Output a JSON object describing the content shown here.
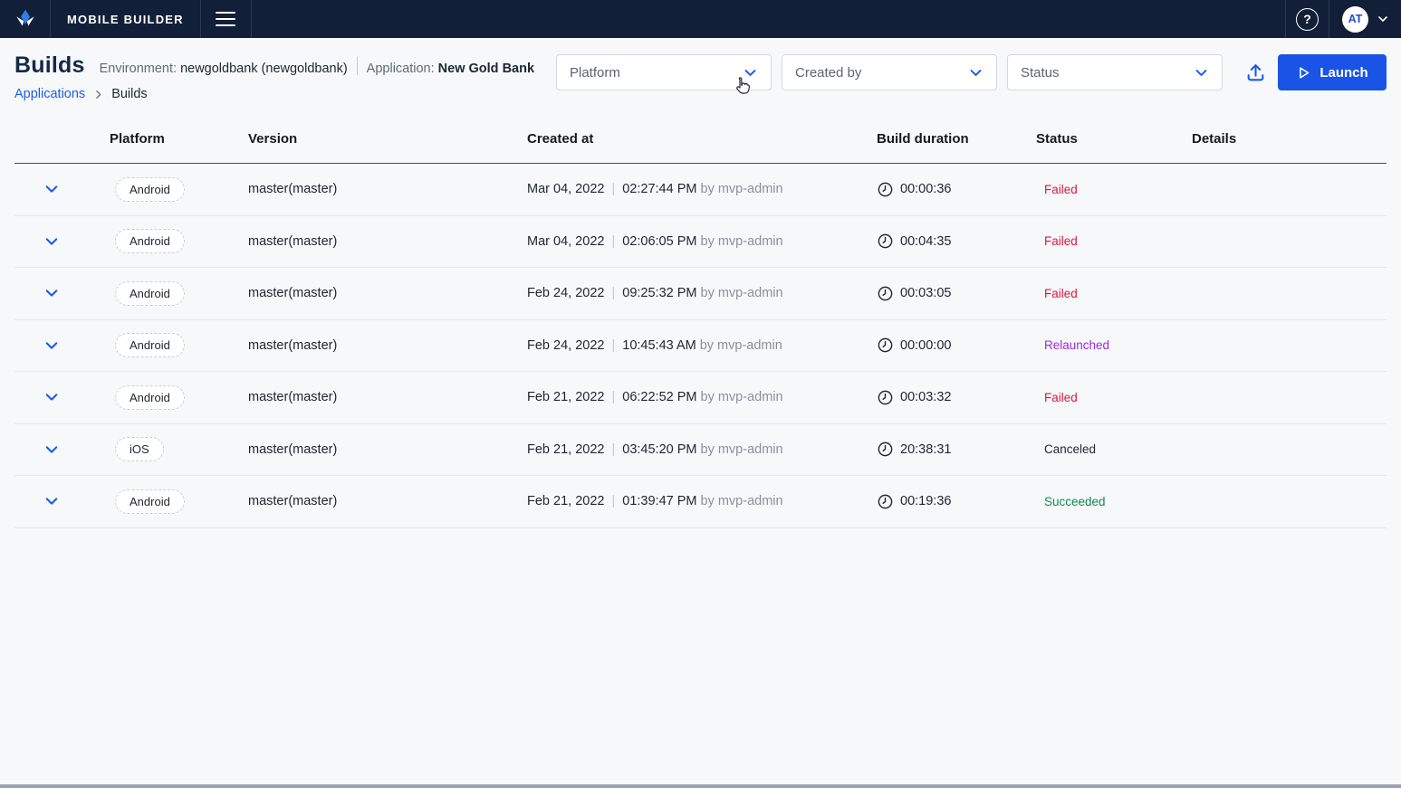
{
  "topbar": {
    "brand": "MOBILE BUILDER",
    "help_glyph": "?",
    "avatar_initials": "AT"
  },
  "header": {
    "title": "Builds",
    "environment_label": "Environment:",
    "environment_value": "newgoldbank (newgoldbank)",
    "application_label": "Application:",
    "application_value": "New Gold Bank",
    "breadcrumb": {
      "root": "Applications",
      "current": "Builds"
    }
  },
  "filters": {
    "platform": "Platform",
    "created_by": "Created by",
    "status": "Status"
  },
  "actions": {
    "launch": "Launch"
  },
  "table": {
    "columns": [
      "Platform",
      "Version",
      "Created at",
      "Build duration",
      "Status",
      "Details"
    ],
    "date_separator": "|",
    "rows": [
      {
        "platform": "Android",
        "version": "master(master)",
        "date": "Mar 04, 2022",
        "time": "02:27:44 PM",
        "by": "by mvp-admin",
        "duration": "00:00:36",
        "status": "Failed"
      },
      {
        "platform": "Android",
        "version": "master(master)",
        "date": "Mar 04, 2022",
        "time": "02:06:05 PM",
        "by": "by mvp-admin",
        "duration": "00:04:35",
        "status": "Failed"
      },
      {
        "platform": "Android",
        "version": "master(master)",
        "date": "Feb 24, 2022",
        "time": "09:25:32 PM",
        "by": "by mvp-admin",
        "duration": "00:03:05",
        "status": "Failed"
      },
      {
        "platform": "Android",
        "version": "master(master)",
        "date": "Feb 24, 2022",
        "time": "10:45:43 AM",
        "by": "by mvp-admin",
        "duration": "00:00:00",
        "status": "Relaunched"
      },
      {
        "platform": "Android",
        "version": "master(master)",
        "date": "Feb 21, 2022",
        "time": "06:22:52 PM",
        "by": "by mvp-admin",
        "duration": "00:03:32",
        "status": "Failed"
      },
      {
        "platform": "iOS",
        "version": "master(master)",
        "date": "Feb 21, 2022",
        "time": "03:45:20 PM",
        "by": "by mvp-admin",
        "duration": "20:38:31",
        "status": "Canceled"
      },
      {
        "platform": "Android",
        "version": "master(master)",
        "date": "Feb 21, 2022",
        "time": "01:39:47 PM",
        "by": "by mvp-admin",
        "duration": "00:19:36",
        "status": "Succeeded"
      }
    ],
    "status_colors": {
      "Failed": "#e0173c",
      "Relaunched": "#9c2bd6",
      "Canceled": "#23272e",
      "Succeeded": "#0c8a4d"
    }
  },
  "colors": {
    "accent": "#1a5ce8",
    "button": "#1a54e6",
    "topbar_bg": "#121f38"
  }
}
